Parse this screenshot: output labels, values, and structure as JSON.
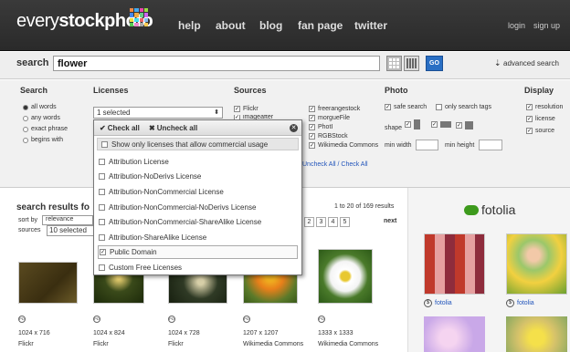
{
  "header": {
    "logo_light": "every",
    "logo_bold": "stockphoto",
    "nav": [
      "help",
      "about",
      "blog",
      "fan page",
      "twitter"
    ],
    "login": "login",
    "signup": "sign up"
  },
  "search": {
    "label": "search",
    "value": "flower",
    "go": "GO",
    "advanced": "advanced search"
  },
  "filters": {
    "search_heading": "Search",
    "search_options": [
      "all words",
      "any words",
      "exact phrase",
      "begins with"
    ],
    "licenses_heading": "Licenses",
    "licenses_selected": "1 selected",
    "sources_heading": "Sources",
    "sources_col1": [
      "Flickr",
      "imageafter"
    ],
    "sources_col2": [
      "freerangestock",
      "morgueFile",
      "PhotI",
      "RGBStock",
      "Wikimedia Commons"
    ],
    "uncheck_check_all": "Uncheck All / Check All",
    "photo_heading": "Photo",
    "safe_search": "safe search",
    "only_search_tags": "only search tags",
    "shape": "shape",
    "min_width": "min width",
    "min_height": "min height",
    "display_heading": "Display",
    "display_options": [
      "resolution",
      "license",
      "source"
    ]
  },
  "license_dropdown": {
    "check_all": "Check all",
    "uncheck_all": "Uncheck all",
    "commercial_only": "Show only licenses that allow commercial usage",
    "items": [
      {
        "label": "Attribution License",
        "checked": false
      },
      {
        "label": "Attribution-NoDerivs License",
        "checked": false
      },
      {
        "label": "Attribution-NonCommercial License",
        "checked": false
      },
      {
        "label": "Attribution-NonCommercial-NoDerivs License",
        "checked": false
      },
      {
        "label": "Attribution-NonCommercial-ShareAlike License",
        "checked": false
      },
      {
        "label": "Attribution-ShareAlike License",
        "checked": false
      },
      {
        "label": "Public Domain",
        "checked": true
      },
      {
        "label": "Custom Free Licenses",
        "checked": false
      }
    ]
  },
  "results": {
    "heading": "search results fo",
    "sort_by_label": "sort by",
    "sort_by_value": "relevance",
    "sources_label": "sources",
    "sources_value": "10 selected",
    "range": "1 to 20 of 169 results",
    "pages": [
      "2",
      "3",
      "4",
      "5"
    ],
    "next": "next",
    "items": [
      {
        "resolution": "1024 x 716",
        "source": "Flickr"
      },
      {
        "resolution": "1024 x 824",
        "source": "Flickr"
      },
      {
        "resolution": "1024 x 728",
        "source": "Flickr"
      },
      {
        "resolution": "1207 x 1207",
        "source": "Wikimedia Commons"
      },
      {
        "resolution": "1333 x 1333",
        "source": "Wikimedia Commons"
      }
    ]
  },
  "sidebar": {
    "brand": "fotolia",
    "captions": [
      "fotolia",
      "fotolia"
    ]
  },
  "colors": {
    "header_bg": "#2f2f2f",
    "go_button": "#2a6fc4",
    "fotolia_green": "#3d9a1c"
  }
}
